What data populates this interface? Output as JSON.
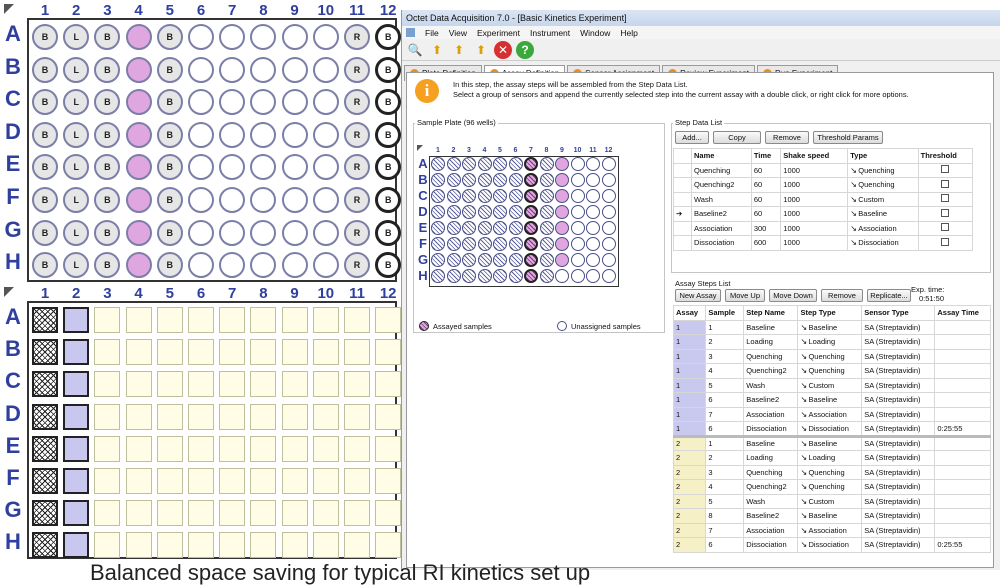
{
  "top_plate": {
    "cols": [
      "1",
      "2",
      "3",
      "4",
      "5",
      "6",
      "7",
      "8",
      "9",
      "10",
      "11",
      "12"
    ],
    "rows": [
      "A",
      "B",
      "C",
      "D",
      "E",
      "F",
      "G",
      "H"
    ],
    "wells": [
      "B",
      "L",
      "B",
      "",
      "B",
      "",
      "",
      "",
      "",
      "",
      "R",
      "B"
    ]
  },
  "bottom_plate": {
    "cols": [
      "1",
      "2",
      "3",
      "4",
      "5",
      "6",
      "7",
      "8",
      "9",
      "10",
      "11",
      "12"
    ],
    "rows": [
      "A",
      "B",
      "C",
      "D",
      "E",
      "F",
      "G",
      "H"
    ]
  },
  "window": {
    "title": "Octet Data Acquisition 7.0 - [Basic Kinetics Experiment]"
  },
  "menu": [
    "File",
    "View",
    "Experiment",
    "Instrument",
    "Window",
    "Help"
  ],
  "toolbar": [
    "new-icon",
    "open-icon",
    "save-icon",
    "export-icon",
    "stop-icon",
    "help-icon"
  ],
  "tabs": [
    "Plate Definition",
    "Assay Definition",
    "Sensor Assignment",
    "Review Experiment",
    "Run Experiment"
  ],
  "info": {
    "line1": "In this step, the assay steps will be assembled from the Step Data List.",
    "line2": "Select a group of sensors and append the currently selected step into the current assay with a double click, or right click for more options."
  },
  "sample_plate": {
    "title": "Sample Plate (96 wells)",
    "cols": [
      "1",
      "2",
      "3",
      "4",
      "5",
      "6",
      "7",
      "8",
      "9",
      "10",
      "11",
      "12"
    ],
    "rows": [
      "A",
      "B",
      "C",
      "D",
      "E",
      "F",
      "G",
      "H"
    ],
    "legend_assayed": "Assayed samples",
    "legend_unassigned": "Unassigned samples"
  },
  "step_data": {
    "title": "Step Data List",
    "buttons": [
      "Add...",
      "Copy",
      "Remove",
      "Threshold Params"
    ],
    "headers": [
      "Name",
      "Time",
      "Shake speed",
      "Type",
      "Threshold"
    ],
    "rows": [
      [
        "Quenching",
        "60",
        "1000",
        "Quenching"
      ],
      [
        "Quenching2",
        "60",
        "1000",
        "Quenching"
      ],
      [
        "Wash",
        "60",
        "1000",
        "Custom"
      ],
      [
        "Baseline2",
        "60",
        "1000",
        "Baseline"
      ],
      [
        "Association",
        "300",
        "1000",
        "Association"
      ],
      [
        "Dissociation",
        "600",
        "1000",
        "Dissociation"
      ]
    ]
  },
  "assay_steps": {
    "title": "Assay Steps List",
    "buttons": [
      "New Assay",
      "Move Up",
      "Move Down",
      "Remove",
      "Replicate..."
    ],
    "exp_time_label": "Exp. time:",
    "exp_time": "0:51:50",
    "headers": [
      "Assay",
      "Sample",
      "Step Name",
      "Step Type",
      "Sensor Type",
      "Assay Time"
    ],
    "rows": [
      [
        "1",
        "1",
        "Baseline",
        "Baseline",
        "SA (Streptavidin)",
        ""
      ],
      [
        "1",
        "2",
        "Loading",
        "Loading",
        "SA (Streptavidin)",
        ""
      ],
      [
        "1",
        "3",
        "Quenching",
        "Quenching",
        "SA (Streptavidin)",
        ""
      ],
      [
        "1",
        "4",
        "Quenching2",
        "Quenching",
        "SA (Streptavidin)",
        ""
      ],
      [
        "1",
        "5",
        "Wash",
        "Custom",
        "SA (Streptavidin)",
        ""
      ],
      [
        "1",
        "6",
        "Baseline2",
        "Baseline",
        "SA (Streptavidin)",
        ""
      ],
      [
        "1",
        "7",
        "Association",
        "Association",
        "SA (Streptavidin)",
        ""
      ],
      [
        "1",
        "6",
        "Dissociation",
        "Dissociation",
        "SA (Streptavidin)",
        "0:25:55"
      ],
      [
        "2",
        "1",
        "Baseline",
        "Baseline",
        "SA (Streptavidin)",
        ""
      ],
      [
        "2",
        "2",
        "Loading",
        "Loading",
        "SA (Streptavidin)",
        ""
      ],
      [
        "2",
        "3",
        "Quenching",
        "Quenching",
        "SA (Streptavidin)",
        ""
      ],
      [
        "2",
        "4",
        "Quenching2",
        "Quenching",
        "SA (Streptavidin)",
        ""
      ],
      [
        "2",
        "5",
        "Wash",
        "Custom",
        "SA (Streptavidin)",
        ""
      ],
      [
        "2",
        "8",
        "Baseline2",
        "Baseline",
        "SA (Streptavidin)",
        ""
      ],
      [
        "2",
        "7",
        "Association",
        "Association",
        "SA (Streptavidin)",
        ""
      ],
      [
        "2",
        "6",
        "Dissociation",
        "Dissociation",
        "SA (Streptavidin)",
        "0:25:55"
      ]
    ]
  },
  "caption": "Balanced space saving for typical RI kinetics set up",
  "colors": {
    "accent": "#2f3f9e",
    "pink": "#dfa6df",
    "blue": "#c7c7ef"
  }
}
